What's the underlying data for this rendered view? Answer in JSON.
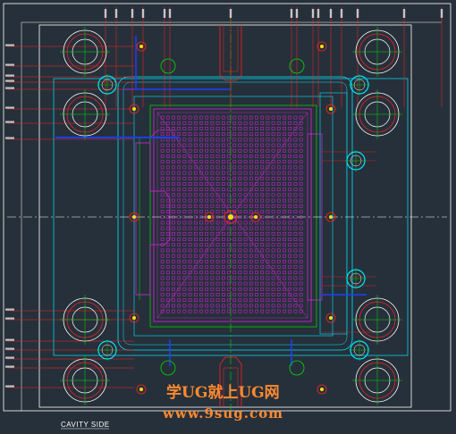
{
  "drawing": {
    "caption": "CAVITY SIDE",
    "watermark_line1": "学UG就上UG网",
    "watermark_line2": "www.9sug.com",
    "colors": {
      "background": "#26303a",
      "outline": "#ffffff",
      "plate": "#00e5ff",
      "centerline": "#00e000",
      "dimension": "#ff2020",
      "water_line": "#1a40ff",
      "cavity": "#e020e0",
      "screw": "#ffe000"
    }
  }
}
